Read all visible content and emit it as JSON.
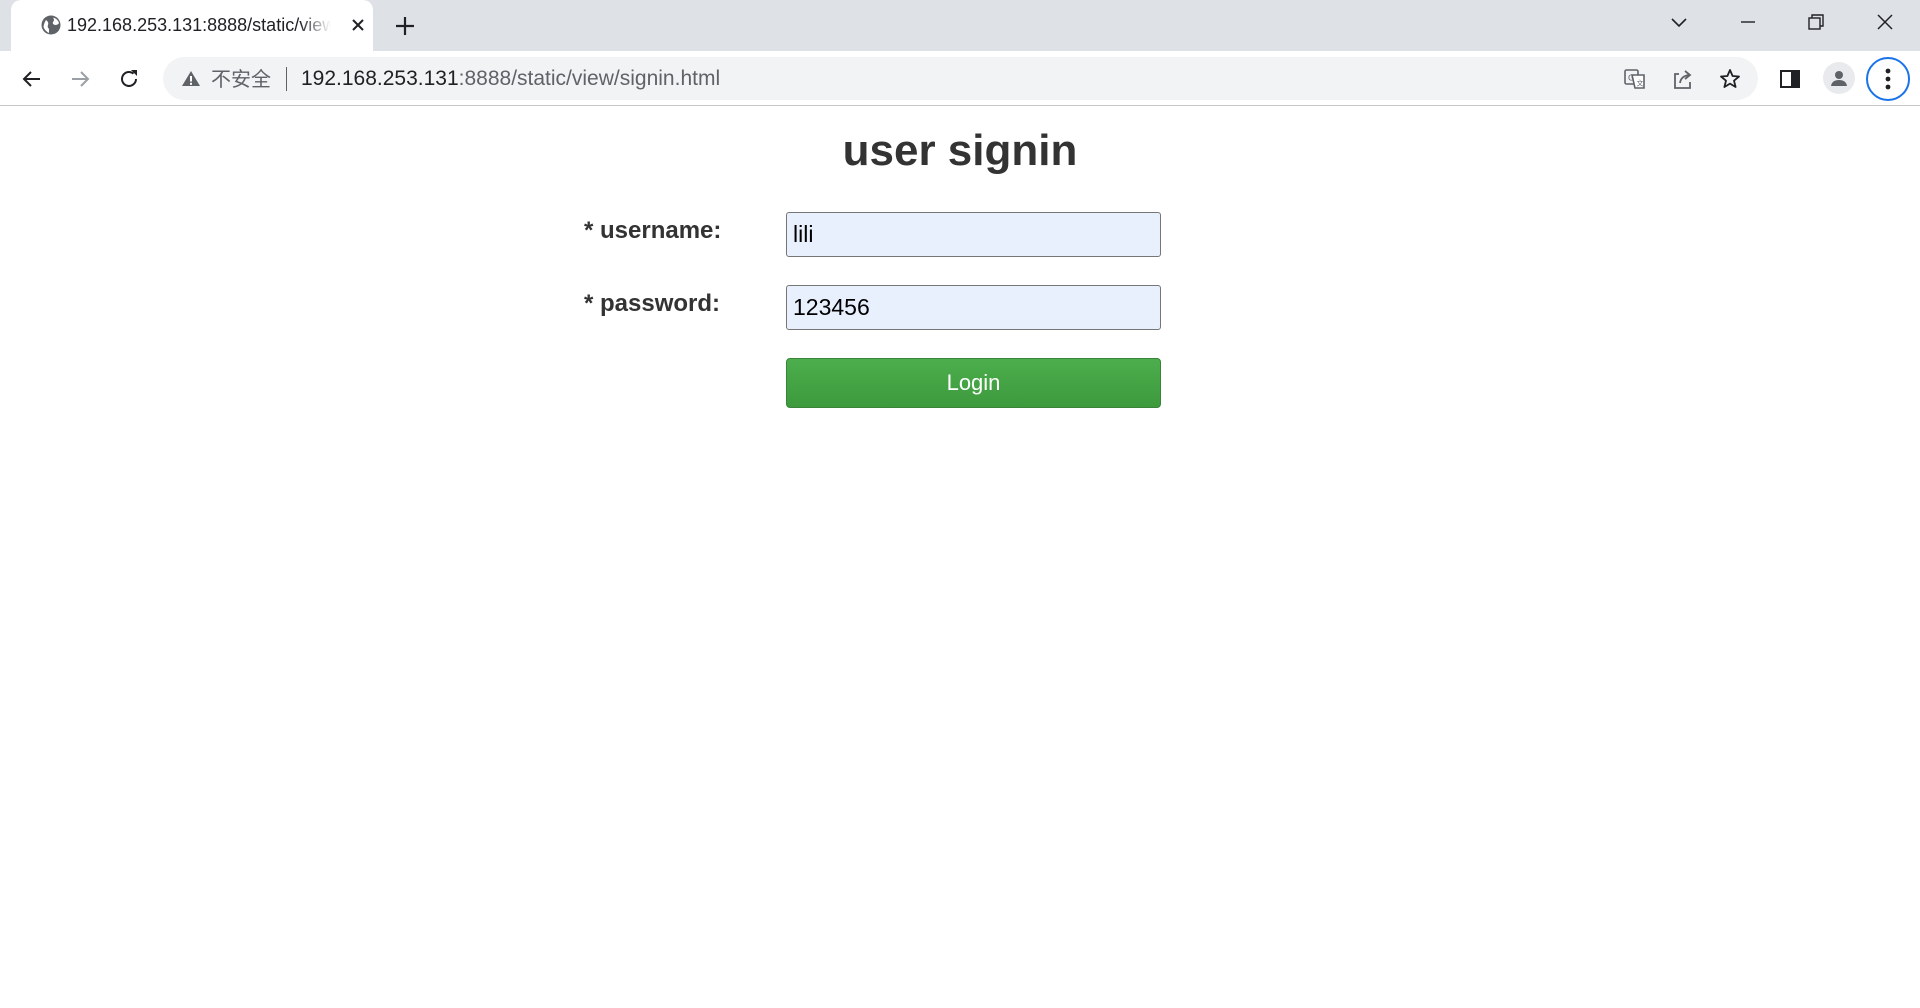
{
  "browser": {
    "tab": {
      "title": "192.168.253.131:8888/static/view/signin.html",
      "favicon": "globe-icon"
    },
    "omnibox": {
      "security_label": "不安全",
      "url_host": "192.168.253.131",
      "url_rest": ":8888/static/view/signin.html"
    }
  },
  "page": {
    "title": "user signin",
    "form": {
      "username_label": "* username:",
      "username_value": "lili",
      "password_label": "* password:",
      "password_value": "123456",
      "submit_label": "Login"
    }
  },
  "colors": {
    "login_button": "#45a745",
    "input_autofill_bg": "#e8f0fe",
    "menu_focus_ring": "#1a73e8"
  }
}
